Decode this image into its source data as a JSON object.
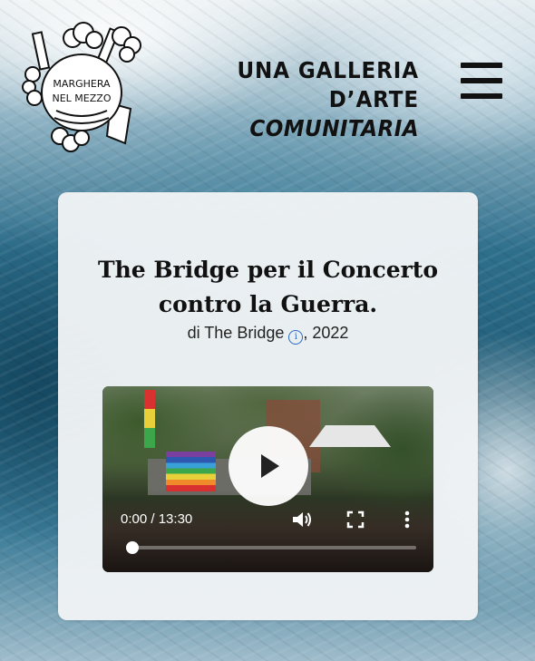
{
  "header": {
    "logo_text": [
      "MARGHERA",
      "NEL MEZZO"
    ],
    "tagline_line1": "UNA GALLERIA D’ARTE",
    "tagline_line2": "COMUNITARIA",
    "menu_icon": "hamburger-menu-icon"
  },
  "artwork": {
    "title": "The Bridge per il Concerto contro la Guerra.",
    "byline_prefix": "di",
    "artist": "The Bridge",
    "info_icon": "info-icon",
    "year_suffix": ", 2022"
  },
  "video": {
    "current_time": "0:00",
    "separator": " / ",
    "duration": "13:30",
    "progress_fraction": 0.0,
    "icons": {
      "play": "play-icon",
      "volume": "volume-icon",
      "fullscreen": "fullscreen-icon",
      "more": "more-options-icon"
    }
  }
}
